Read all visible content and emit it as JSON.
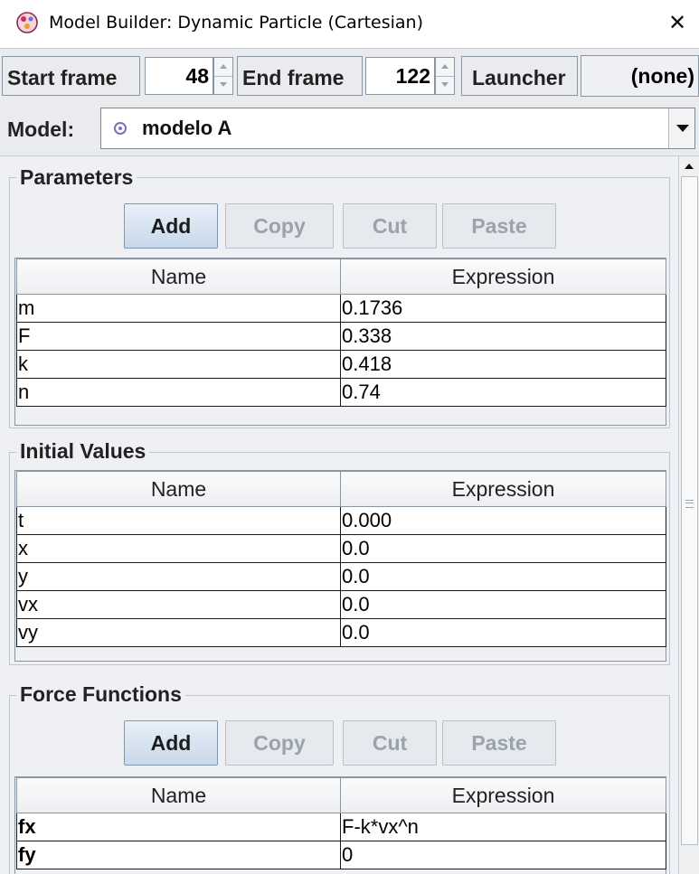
{
  "window": {
    "title": "Model Builder: Dynamic Particle (Cartesian)",
    "close_glyph": "✕"
  },
  "toolbar": {
    "start_label": "Start frame",
    "start_value": "48",
    "end_label": "End frame",
    "end_value": "122",
    "launcher_label": "Launcher",
    "launcher_value": "(none)"
  },
  "model": {
    "label": "Model:",
    "selected": "modelo A",
    "icon": "particle-dot-icon",
    "icon_color": "#7a6fb8"
  },
  "parameters": {
    "title": "Parameters",
    "buttons": {
      "add": "Add",
      "copy": "Copy",
      "cut": "Cut",
      "paste": "Paste"
    },
    "columns": [
      "Name",
      "Expression"
    ],
    "rows": [
      {
        "name": "m",
        "expression": "0.1736"
      },
      {
        "name": "F",
        "expression": "0.338"
      },
      {
        "name": "k",
        "expression": "0.418"
      },
      {
        "name": "n",
        "expression": "0.74"
      }
    ]
  },
  "initial_values": {
    "title": "Initial Values",
    "columns": [
      "Name",
      "Expression"
    ],
    "rows": [
      {
        "name": "t",
        "expression": "0.000"
      },
      {
        "name": "x",
        "expression": "0.0"
      },
      {
        "name": "y",
        "expression": "0.0"
      },
      {
        "name": "vx",
        "expression": "0.0"
      },
      {
        "name": "vy",
        "expression": "0.0"
      }
    ]
  },
  "force_functions": {
    "title": "Force Functions",
    "buttons": {
      "add": "Add",
      "copy": "Copy",
      "cut": "Cut",
      "paste": "Paste"
    },
    "columns": [
      "Name",
      "Expression"
    ],
    "rows": [
      {
        "name": "fx",
        "expression": "F-k*vx^n"
      },
      {
        "name": "fy",
        "expression": "0"
      }
    ]
  },
  "colors": {
    "active_button": "#c8d8ea",
    "disabled_text": "#9aa2ab",
    "panel_bg": "#eef0f3"
  }
}
